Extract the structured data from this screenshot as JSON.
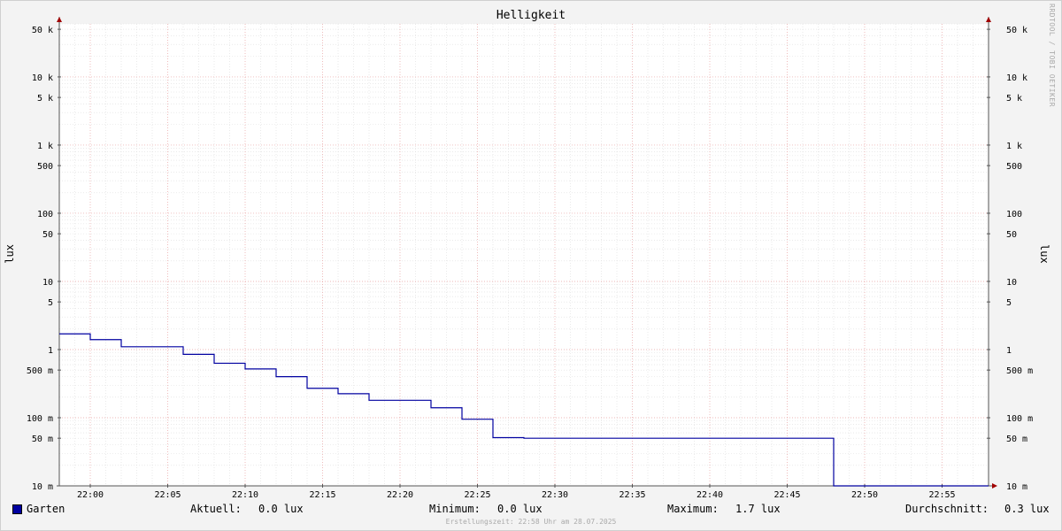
{
  "title": "Helligkeit",
  "watermark": "RRDTOOL / TOBI OETIKER",
  "footer": "Erstellungszeit: 22:58 Uhr am 28.07.2025",
  "legend": {
    "series_name": "Garten",
    "series_color": "#0000a0",
    "current_label": "Aktuell:",
    "current_value": "0.0 lux",
    "min_label": "Minimum:",
    "min_value": "0.0 lux",
    "max_label": "Maximum:",
    "max_value": "1.7 lux",
    "avg_label": "Durchschnitt:",
    "avg_value": "0.3 lux"
  },
  "chart_data": {
    "type": "line",
    "title": "Helligkeit",
    "ylabel": "lux",
    "xlabel": "",
    "yscale": "log",
    "ylim": [
      10,
      60000
    ],
    "xlim": [
      "21:58",
      "22:58"
    ],
    "grid": true,
    "x_ticks": [
      "22:00",
      "22:05",
      "22:10",
      "22:15",
      "22:20",
      "22:25",
      "22:30",
      "22:35",
      "22:40",
      "22:45",
      "22:50",
      "22:55"
    ],
    "y_ticks": [
      {
        "value": 50000,
        "label": "50 k"
      },
      {
        "value": 10000,
        "label": "10 k"
      },
      {
        "value": 5000,
        "label": "5 k"
      },
      {
        "value": 1000,
        "label": "1 k"
      },
      {
        "value": 500,
        "label": "500"
      },
      {
        "value": 100,
        "label": "100"
      },
      {
        "value": 50,
        "label": "50"
      },
      {
        "value": 10,
        "label": "10"
      },
      {
        "value": 5,
        "label": "5"
      },
      {
        "value": 1,
        "label": "1"
      },
      {
        "value": 0.5,
        "label": "500 m"
      },
      {
        "value": 0.1,
        "label": "100 m"
      },
      {
        "value": 0.05,
        "label": "50 m"
      },
      {
        "value": 0.01,
        "label": "10 m"
      }
    ],
    "series": [
      {
        "name": "Garten",
        "color": "#0000a0",
        "step": true,
        "points": [
          {
            "x": "21:58",
            "y": 1.7
          },
          {
            "x": "22:00",
            "y": 1.4
          },
          {
            "x": "22:02",
            "y": 1.1
          },
          {
            "x": "22:06",
            "y": 0.85
          },
          {
            "x": "22:08",
            "y": 0.63
          },
          {
            "x": "22:10",
            "y": 0.52
          },
          {
            "x": "22:12",
            "y": 0.4
          },
          {
            "x": "22:14",
            "y": 0.27
          },
          {
            "x": "22:16",
            "y": 0.225
          },
          {
            "x": "22:18",
            "y": 0.18
          },
          {
            "x": "22:22",
            "y": 0.14
          },
          {
            "x": "22:24",
            "y": 0.095
          },
          {
            "x": "22:26",
            "y": 0.051
          },
          {
            "x": "22:28",
            "y": 0.05
          },
          {
            "x": "22:48",
            "y": 0.01
          },
          {
            "x": "22:58",
            "y": 0.01
          }
        ]
      }
    ]
  }
}
